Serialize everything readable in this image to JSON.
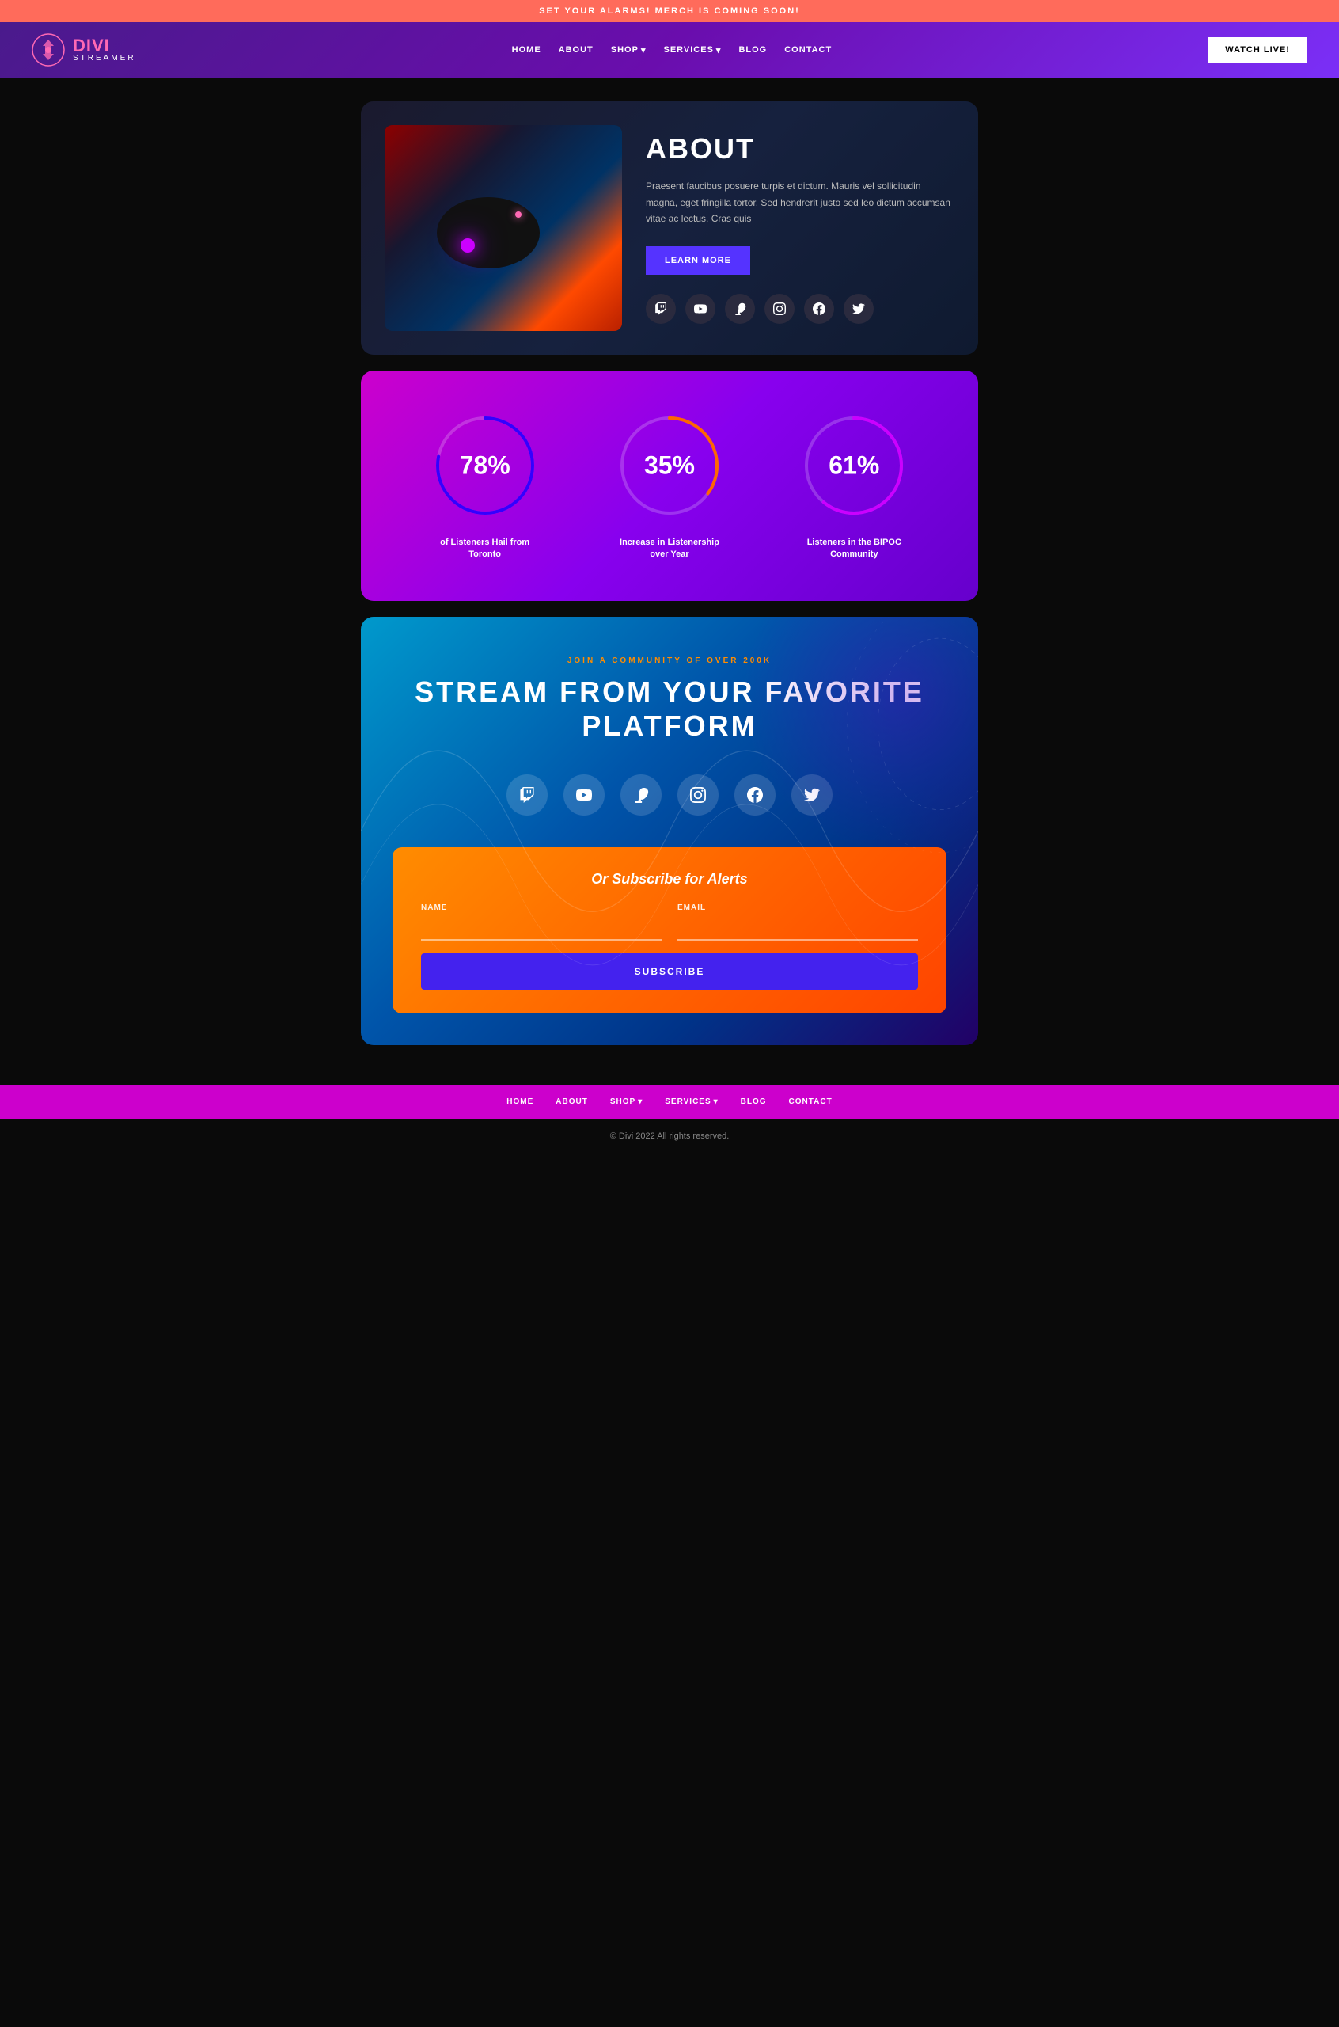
{
  "topBanner": {
    "text": "SET YOUR ALARMS! MERCH IS COMING SOON!"
  },
  "header": {
    "logo": {
      "brand": "DIVI",
      "subtitle": "STREAMER"
    },
    "nav": [
      {
        "label": "HOME",
        "hasDropdown": false
      },
      {
        "label": "ABOUT",
        "hasDropdown": false
      },
      {
        "label": "SHOP",
        "hasDropdown": true
      },
      {
        "label": "SERVICES",
        "hasDropdown": true
      },
      {
        "label": "BLOG",
        "hasDropdown": false
      },
      {
        "label": "CONTACT",
        "hasDropdown": false
      }
    ],
    "watchLiveButton": "WATCH LIVE!"
  },
  "about": {
    "title": "ABOUT",
    "text": "Praesent faucibus posuere turpis et dictum. Mauris vel sollicitudin magna, eget fringilla tortor. Sed hendrerit justo sed leo dictum accumsan vitae ac lectus. Cras quis",
    "learnMoreButton": "LEARN MORE",
    "socialIcons": [
      "twitch",
      "youtube",
      "patreon",
      "instagram",
      "facebook",
      "twitter"
    ]
  },
  "stats": [
    {
      "value": "78%",
      "label": "of Listeners Hail from Toronto",
      "percent": 78,
      "circleColor1": "#aa00ff",
      "circleColor2": "#3300ff"
    },
    {
      "value": "35%",
      "label": "Increase in Listenership over Year",
      "percent": 35,
      "circleColor1": "#ff6600",
      "circleColor2": "#aa00ff"
    },
    {
      "value": "61%",
      "label": "Listeners in the BIPOC Community",
      "percent": 61,
      "circleColor1": "#cc00ff",
      "circleColor2": "#6600cc"
    }
  ],
  "streamSection": {
    "subtitle": "JOIN A COMMUNITY OF OVER 200K",
    "title": "STREAM FROM YOUR FAVORITE\nPLATFORM",
    "icons": [
      "twitch",
      "youtube",
      "patreon",
      "instagram",
      "facebook",
      "twitter"
    ]
  },
  "subscribe": {
    "title": "Or Subscribe for Alerts",
    "namePlaceholder": "",
    "emailPlaceholder": "",
    "nameLabel": "NAME",
    "emailLabel": "EMAIL",
    "buttonLabel": "SUBSCRIBE"
  },
  "footerNav": [
    {
      "label": "HOME",
      "hasDropdown": false
    },
    {
      "label": "ABOUT",
      "hasDropdown": false
    },
    {
      "label": "SHOP",
      "hasDropdown": true
    },
    {
      "label": "SERVICES",
      "hasDropdown": true
    },
    {
      "label": "BLOG",
      "hasDropdown": false
    },
    {
      "label": "CONTACT",
      "hasDropdown": false
    }
  ],
  "footerCopyright": "© Divi 2022 All rights reserved.",
  "icons": {
    "twitch": "𝕋",
    "youtube": "▶",
    "patreon": "𝐏",
    "instagram": "📷",
    "facebook": "f",
    "twitter": "🐦",
    "chevron": "▾"
  }
}
